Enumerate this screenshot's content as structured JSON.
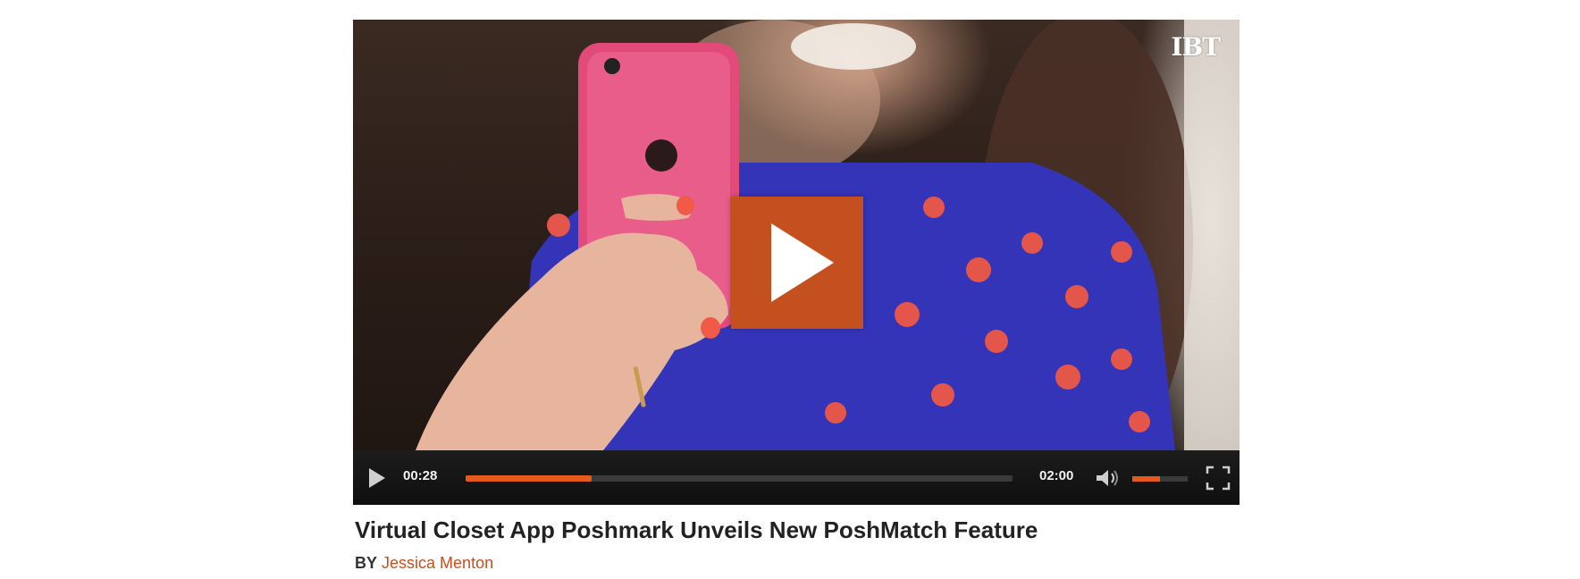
{
  "video": {
    "watermark": "IBT",
    "current_time": "00:28",
    "total_time": "02:00",
    "progress": 0.23,
    "volume": 0.5
  },
  "article": {
    "title": "Virtual Closet App Poshmark Unveils New PoshMatch Feature",
    "by_prefix": "BY",
    "author": "Jessica Menton"
  },
  "colors": {
    "accent": "#c4501f",
    "progress": "#e55a1c"
  },
  "icons": {
    "big_play": "play-icon",
    "control_play": "play-icon",
    "volume": "volume-icon",
    "fullscreen": "fullscreen-icon"
  }
}
